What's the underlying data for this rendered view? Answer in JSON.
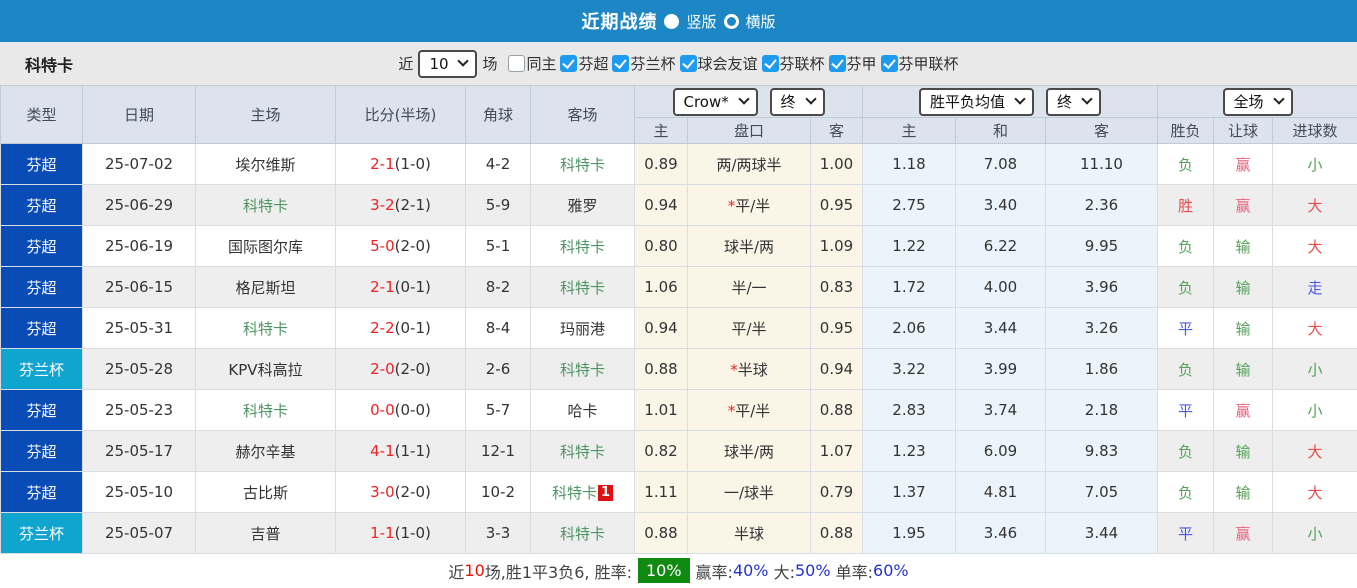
{
  "colors": {
    "topbar_blue": "#1d87c6",
    "league_super_blue": "#0a4cb5",
    "league_cup_cyan": "#0fa5ce",
    "checkbox_blue": "#1e9bef",
    "focus_team_green": "#4f9463",
    "score_red": "#ee2222",
    "result_green": "#55a158",
    "result_red": "#e84b4b",
    "result_pink": "#e8607a",
    "result_blue": "#4a5ae0",
    "summary_badge_green": "#118a11",
    "summary_value_blue": "#2233cc"
  },
  "topbar": {
    "title": "近期战绩",
    "layout_options": [
      {
        "label": "竖版",
        "selected": true
      },
      {
        "label": "横版",
        "selected": false
      }
    ]
  },
  "filter": {
    "team": "科特卡",
    "near_label": "近",
    "count_value": "10",
    "count_suffix": "场",
    "options": [
      {
        "label": "同主",
        "checked": false
      },
      {
        "label": "芬超",
        "checked": true
      },
      {
        "label": "芬兰杯",
        "checked": true
      },
      {
        "label": "球会友谊",
        "checked": true
      },
      {
        "label": "芬联杯",
        "checked": true
      },
      {
        "label": "芬甲",
        "checked": true
      },
      {
        "label": "芬甲联杯",
        "checked": true
      }
    ]
  },
  "table": {
    "main_headers": [
      "类型",
      "日期",
      "主场",
      "比分(半场)",
      "角球",
      "客场"
    ],
    "selects": {
      "bookmaker": "Crow*",
      "bookmaker_period": "终",
      "average": "胜平负均值",
      "average_period": "终",
      "scope": "全场"
    },
    "sub_headers": [
      "主",
      "盘口",
      "客",
      "主",
      "和",
      "客",
      "胜负",
      "让球",
      "进球数"
    ],
    "rows": [
      {
        "league": "芬超",
        "league_type": "super",
        "date": "25-07-02",
        "home": "埃尔维斯",
        "home_focus": false,
        "score_ft": "2-1",
        "score_ht": "(1-0)",
        "corners": "4-2",
        "away": "科特卡",
        "away_focus": true,
        "away_badge": "",
        "ah_home": "0.89",
        "handicap_star": false,
        "handicap": "两/两球半",
        "ah_away": "1.00",
        "odds_home": "1.18",
        "odds_draw": "7.08",
        "odds_away": "11.10",
        "result_outcome": "负",
        "result_outcome_color": "green",
        "result_handicap": "赢",
        "result_handicap_color": "pink",
        "result_goals": "小",
        "result_goals_color": "green"
      },
      {
        "league": "芬超",
        "league_type": "super",
        "date": "25-06-29",
        "home": "科特卡",
        "home_focus": true,
        "score_ft": "3-2",
        "score_ht": "(2-1)",
        "corners": "5-9",
        "away": "雅罗",
        "away_focus": false,
        "away_badge": "",
        "ah_home": "0.94",
        "handicap_star": true,
        "handicap": "平/半",
        "ah_away": "0.95",
        "odds_home": "2.75",
        "odds_draw": "3.40",
        "odds_away": "2.36",
        "result_outcome": "胜",
        "result_outcome_color": "red",
        "result_handicap": "赢",
        "result_handicap_color": "pink",
        "result_goals": "大",
        "result_goals_color": "red"
      },
      {
        "league": "芬超",
        "league_type": "super",
        "date": "25-06-19",
        "home": "国际图尔库",
        "home_focus": false,
        "score_ft": "5-0",
        "score_ht": "(2-0)",
        "corners": "5-1",
        "away": "科特卡",
        "away_focus": true,
        "away_badge": "",
        "ah_home": "0.80",
        "handicap_star": false,
        "handicap": "球半/两",
        "ah_away": "1.09",
        "odds_home": "1.22",
        "odds_draw": "6.22",
        "odds_away": "9.95",
        "result_outcome": "负",
        "result_outcome_color": "green",
        "result_handicap": "输",
        "result_handicap_color": "green",
        "result_goals": "大",
        "result_goals_color": "red"
      },
      {
        "league": "芬超",
        "league_type": "super",
        "date": "25-06-15",
        "home": "格尼斯坦",
        "home_focus": false,
        "score_ft": "2-1",
        "score_ht": "(0-1)",
        "corners": "8-2",
        "away": "科特卡",
        "away_focus": true,
        "away_badge": "",
        "ah_home": "1.06",
        "handicap_star": false,
        "handicap": "半/一",
        "ah_away": "0.83",
        "odds_home": "1.72",
        "odds_draw": "4.00",
        "odds_away": "3.96",
        "result_outcome": "负",
        "result_outcome_color": "green",
        "result_handicap": "输",
        "result_handicap_color": "green",
        "result_goals": "走",
        "result_goals_color": "blue"
      },
      {
        "league": "芬超",
        "league_type": "super",
        "date": "25-05-31",
        "home": "科特卡",
        "home_focus": true,
        "score_ft": "2-2",
        "score_ht": "(0-1)",
        "corners": "8-4",
        "away": "玛丽港",
        "away_focus": false,
        "away_badge": "",
        "ah_home": "0.94",
        "handicap_star": false,
        "handicap": "平/半",
        "ah_away": "0.95",
        "odds_home": "2.06",
        "odds_draw": "3.44",
        "odds_away": "3.26",
        "result_outcome": "平",
        "result_outcome_color": "blue",
        "result_handicap": "输",
        "result_handicap_color": "green",
        "result_goals": "大",
        "result_goals_color": "red"
      },
      {
        "league": "芬兰杯",
        "league_type": "cup",
        "date": "25-05-28",
        "home": "KPV科高拉",
        "home_focus": false,
        "score_ft": "2-0",
        "score_ht": "(2-0)",
        "corners": "2-6",
        "away": "科特卡",
        "away_focus": true,
        "away_badge": "",
        "ah_home": "0.88",
        "handicap_star": true,
        "handicap": "半球",
        "ah_away": "0.94",
        "odds_home": "3.22",
        "odds_draw": "3.99",
        "odds_away": "1.86",
        "result_outcome": "负",
        "result_outcome_color": "green",
        "result_handicap": "输",
        "result_handicap_color": "green",
        "result_goals": "小",
        "result_goals_color": "green"
      },
      {
        "league": "芬超",
        "league_type": "super",
        "date": "25-05-23",
        "home": "科特卡",
        "home_focus": true,
        "score_ft": "0-0",
        "score_ht": "(0-0)",
        "corners": "5-7",
        "away": "哈卡",
        "away_focus": false,
        "away_badge": "",
        "ah_home": "1.01",
        "handicap_star": true,
        "handicap": "平/半",
        "ah_away": "0.88",
        "odds_home": "2.83",
        "odds_draw": "3.74",
        "odds_away": "2.18",
        "result_outcome": "平",
        "result_outcome_color": "blue",
        "result_handicap": "赢",
        "result_handicap_color": "pink",
        "result_goals": "小",
        "result_goals_color": "green"
      },
      {
        "league": "芬超",
        "league_type": "super",
        "date": "25-05-17",
        "home": "赫尔辛基",
        "home_focus": false,
        "score_ft": "4-1",
        "score_ht": "(1-1)",
        "corners": "12-1",
        "away": "科特卡",
        "away_focus": true,
        "away_badge": "",
        "ah_home": "0.82",
        "handicap_star": false,
        "handicap": "球半/两",
        "ah_away": "1.07",
        "odds_home": "1.23",
        "odds_draw": "6.09",
        "odds_away": "9.83",
        "result_outcome": "负",
        "result_outcome_color": "green",
        "result_handicap": "输",
        "result_handicap_color": "green",
        "result_goals": "大",
        "result_goals_color": "red"
      },
      {
        "league": "芬超",
        "league_type": "super",
        "date": "25-05-10",
        "home": "古比斯",
        "home_focus": false,
        "score_ft": "3-0",
        "score_ht": "(2-0)",
        "corners": "10-2",
        "away": "科特卡",
        "away_focus": true,
        "away_badge": "1",
        "ah_home": "1.11",
        "handicap_star": false,
        "handicap": "一/球半",
        "ah_away": "0.79",
        "odds_home": "1.37",
        "odds_draw": "4.81",
        "odds_away": "7.05",
        "result_outcome": "负",
        "result_outcome_color": "green",
        "result_handicap": "输",
        "result_handicap_color": "green",
        "result_goals": "大",
        "result_goals_color": "red"
      },
      {
        "league": "芬兰杯",
        "league_type": "cup",
        "date": "25-05-07",
        "home": "吉普",
        "home_focus": false,
        "score_ft": "1-1",
        "score_ht": "(1-0)",
        "corners": "3-3",
        "away": "科特卡",
        "away_focus": true,
        "away_badge": "",
        "ah_home": "0.88",
        "handicap_star": false,
        "handicap": "半球",
        "ah_away": "0.88",
        "odds_home": "1.95",
        "odds_draw": "3.46",
        "odds_away": "3.44",
        "result_outcome": "平",
        "result_outcome_color": "blue",
        "result_handicap": "赢",
        "result_handicap_color": "pink",
        "result_goals": "小",
        "result_goals_color": "green"
      }
    ]
  },
  "summary": {
    "segments": [
      {
        "text": "近",
        "style": "dark"
      },
      {
        "text": "10",
        "style": "red"
      },
      {
        "text": "场,胜1平3负6, 胜率:",
        "style": "dark"
      },
      {
        "text": "10%",
        "style": "badge"
      },
      {
        "text": "赢率:",
        "style": "dark"
      },
      {
        "text": "40%",
        "style": "blue"
      },
      {
        "text": " 大:",
        "style": "dark"
      },
      {
        "text": "50%",
        "style": "blue"
      },
      {
        "text": " 单率:",
        "style": "dark"
      },
      {
        "text": "60%",
        "style": "blue"
      }
    ]
  }
}
